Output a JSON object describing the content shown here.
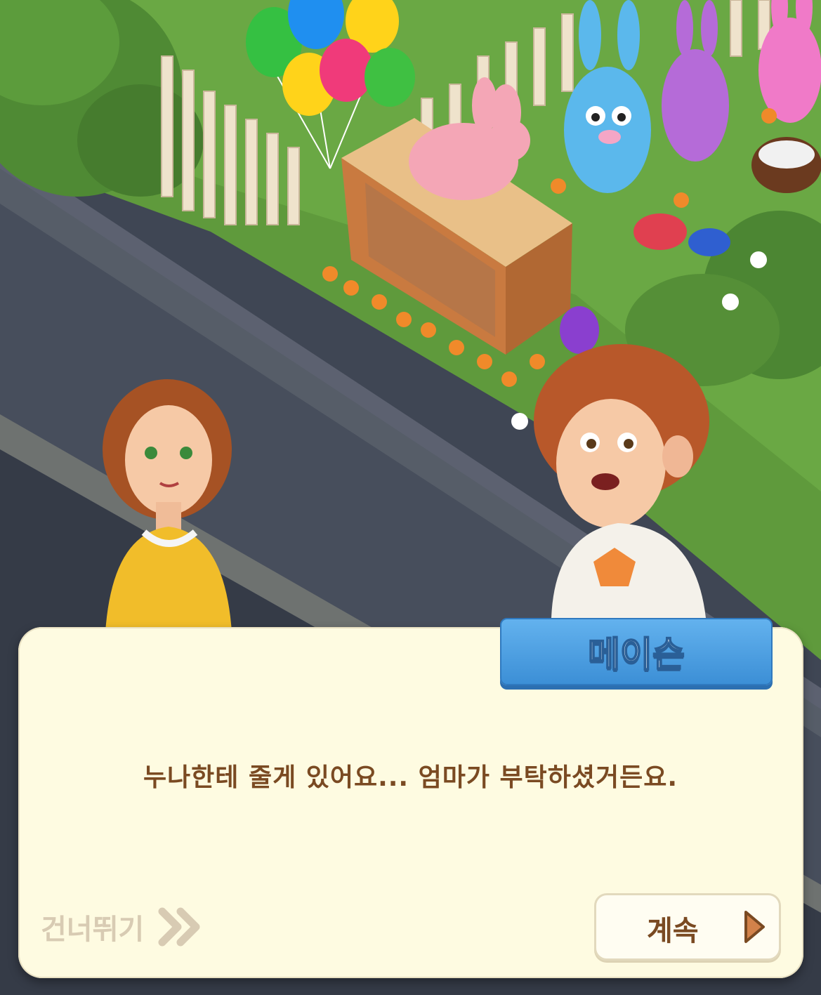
{
  "speaker": {
    "name": "메이슨"
  },
  "dialog": {
    "text": "누나한테 줄게 있어요... 엄마가 부탁하셨거든요."
  },
  "controls": {
    "skip_label": "건너뛰기",
    "skip_icon": "double-chevron-right-icon",
    "continue_label": "계속",
    "continue_icon": "play-triangle-icon"
  },
  "colors": {
    "dialog_bg": "#fefbe1",
    "name_tag": "#4ea0e3",
    "dialog_text": "#7a4a22",
    "continue_arrow": "#d2824a"
  }
}
